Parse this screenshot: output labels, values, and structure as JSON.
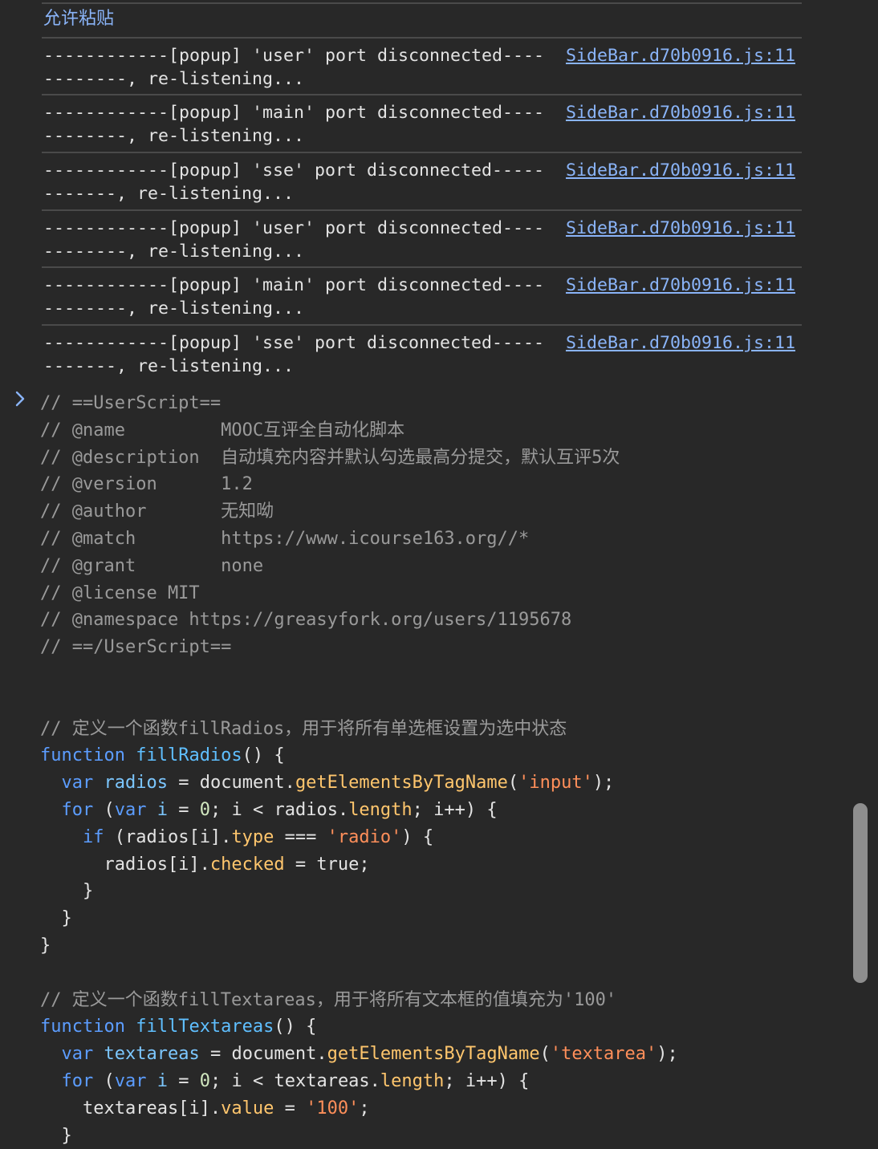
{
  "console": {
    "paste_notice": "允许粘贴",
    "logs": [
      {
        "text": "------------[popup] 'user' port disconnected----\n--------, re-listening...",
        "source": "SideBar.d70b0916.js:11"
      },
      {
        "text": "------------[popup] 'main' port disconnected----\n--------, re-listening...",
        "source": "SideBar.d70b0916.js:11"
      },
      {
        "text": "------------[popup] 'sse' port disconnected-----\n-------, re-listening...",
        "source": "SideBar.d70b0916.js:11"
      },
      {
        "text": "------------[popup] 'user' port disconnected----\n--------, re-listening...",
        "source": "SideBar.d70b0916.js:11"
      },
      {
        "text": "------------[popup] 'main' port disconnected----\n--------, re-listening...",
        "source": "SideBar.d70b0916.js:11"
      },
      {
        "text": "------------[popup] 'sse' port disconnected-----\n-------, re-listening...",
        "source": "SideBar.d70b0916.js:11"
      }
    ]
  },
  "prompt": {
    "icon": "chevron-right-icon",
    "code_lines": [
      [
        {
          "t": "// ==UserScript==",
          "c": "com"
        }
      ],
      [
        {
          "t": "// @name         MOOC互评全自动化脚本",
          "c": "com"
        }
      ],
      [
        {
          "t": "// @description  自动填充内容并默认勾选最高分提交，默认互评5次",
          "c": "com"
        }
      ],
      [
        {
          "t": "// @version      1.2",
          "c": "com"
        }
      ],
      [
        {
          "t": "// @author       无知呦",
          "c": "com"
        }
      ],
      [
        {
          "t": "// @match        https://www.icourse163.org//*",
          "c": "com"
        }
      ],
      [
        {
          "t": "// @grant        none",
          "c": "com"
        }
      ],
      [
        {
          "t": "// @license MIT",
          "c": "com"
        }
      ],
      [
        {
          "t": "// @namespace https://greasyfork.org/users/1195678",
          "c": "com"
        }
      ],
      [
        {
          "t": "// ==/UserScript==",
          "c": "com"
        }
      ],
      [],
      [],
      [
        {
          "t": "// 定义一个函数fillRadios，用于将所有单选框设置为选中状态",
          "c": "com"
        }
      ],
      [
        {
          "t": "function",
          "c": "kw"
        },
        {
          "t": " ",
          "c": "plain"
        },
        {
          "t": "fillRadios",
          "c": "fn"
        },
        {
          "t": "() {",
          "c": "plain"
        }
      ],
      [
        {
          "t": "  ",
          "c": "plain"
        },
        {
          "t": "var",
          "c": "kw"
        },
        {
          "t": " ",
          "c": "plain"
        },
        {
          "t": "radios",
          "c": "var"
        },
        {
          "t": " = document.",
          "c": "plain"
        },
        {
          "t": "getElementsByTagName",
          "c": "prop"
        },
        {
          "t": "(",
          "c": "plain"
        },
        {
          "t": "'input'",
          "c": "str"
        },
        {
          "t": ");",
          "c": "plain"
        }
      ],
      [
        {
          "t": "  ",
          "c": "plain"
        },
        {
          "t": "for",
          "c": "kw"
        },
        {
          "t": " (",
          "c": "plain"
        },
        {
          "t": "var",
          "c": "kw"
        },
        {
          "t": " ",
          "c": "plain"
        },
        {
          "t": "i",
          "c": "var"
        },
        {
          "t": " = ",
          "c": "plain"
        },
        {
          "t": "0",
          "c": "num"
        },
        {
          "t": "; i < radios.",
          "c": "plain"
        },
        {
          "t": "length",
          "c": "prop"
        },
        {
          "t": "; i++) {",
          "c": "plain"
        }
      ],
      [
        {
          "t": "    ",
          "c": "plain"
        },
        {
          "t": "if",
          "c": "kw"
        },
        {
          "t": " (radios[i].",
          "c": "plain"
        },
        {
          "t": "type",
          "c": "prop"
        },
        {
          "t": " === ",
          "c": "plain"
        },
        {
          "t": "'radio'",
          "c": "str"
        },
        {
          "t": ") {",
          "c": "plain"
        }
      ],
      [
        {
          "t": "      radios[i].",
          "c": "plain"
        },
        {
          "t": "checked",
          "c": "prop"
        },
        {
          "t": " = ",
          "c": "plain"
        },
        {
          "t": "true",
          "c": "bool"
        },
        {
          "t": ";",
          "c": "plain"
        }
      ],
      [
        {
          "t": "    }",
          "c": "plain"
        }
      ],
      [
        {
          "t": "  }",
          "c": "plain"
        }
      ],
      [
        {
          "t": "}",
          "c": "plain"
        }
      ],
      [],
      [
        {
          "t": "// 定义一个函数fillTextareas，用于将所有文本框的值填充为'100'",
          "c": "com"
        }
      ],
      [
        {
          "t": "function",
          "c": "kw"
        },
        {
          "t": " ",
          "c": "plain"
        },
        {
          "t": "fillTextareas",
          "c": "fn"
        },
        {
          "t": "() {",
          "c": "plain"
        }
      ],
      [
        {
          "t": "  ",
          "c": "plain"
        },
        {
          "t": "var",
          "c": "kw"
        },
        {
          "t": " ",
          "c": "plain"
        },
        {
          "t": "textareas",
          "c": "var"
        },
        {
          "t": " = document.",
          "c": "plain"
        },
        {
          "t": "getElementsByTagName",
          "c": "prop"
        },
        {
          "t": "(",
          "c": "plain"
        },
        {
          "t": "'textarea'",
          "c": "str"
        },
        {
          "t": ");",
          "c": "plain"
        }
      ],
      [
        {
          "t": "  ",
          "c": "plain"
        },
        {
          "t": "for",
          "c": "kw"
        },
        {
          "t": " (",
          "c": "plain"
        },
        {
          "t": "var",
          "c": "kw"
        },
        {
          "t": " ",
          "c": "plain"
        },
        {
          "t": "i",
          "c": "var"
        },
        {
          "t": " = ",
          "c": "plain"
        },
        {
          "t": "0",
          "c": "num"
        },
        {
          "t": "; i < textareas.",
          "c": "plain"
        },
        {
          "t": "length",
          "c": "prop"
        },
        {
          "t": "; i++) {",
          "c": "plain"
        }
      ],
      [
        {
          "t": "    textareas[i].",
          "c": "plain"
        },
        {
          "t": "value",
          "c": "prop"
        },
        {
          "t": " = ",
          "c": "plain"
        },
        {
          "t": "'100'",
          "c": "str"
        },
        {
          "t": ";",
          "c": "plain"
        }
      ],
      [
        {
          "t": "  }",
          "c": "plain"
        }
      ]
    ]
  },
  "colors": {
    "background": "#282828",
    "link": "#8ab4f8",
    "keyword": "#5c9dff",
    "string": "#ff8f5a",
    "property": "#ffc66d",
    "comment": "#9a9a9a"
  }
}
